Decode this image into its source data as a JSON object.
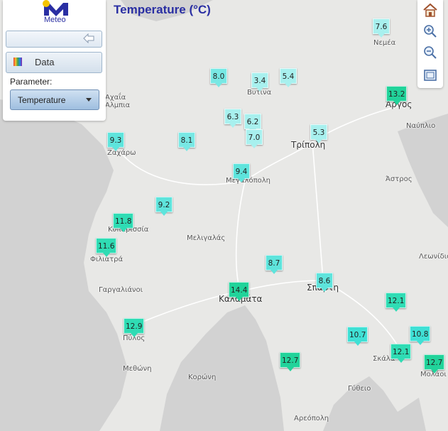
{
  "app": {
    "logo_text": "Meteo",
    "title": "Temperature (°C)"
  },
  "panel": {
    "data_button_label": "Data",
    "parameter_label": "Parameter:",
    "parameter_value": "Temperature"
  },
  "toolbar": {
    "icons": [
      "home-icon",
      "zoom-in-icon",
      "zoom-out-icon",
      "zoom-extent-icon"
    ]
  },
  "colors": {
    "title": "#2a2fa3",
    "marker_low": "#a8f0ee",
    "marker_mid": "#3fe0d5",
    "marker_high": "#21d39a"
  },
  "places": [
    "Νεμέα",
    "Αχαΐα",
    "Αλμπια",
    "Βυτινα",
    "Άργος",
    "Ναύπλιο",
    "Τρίπολη",
    "Ζαχάρω",
    "Μεγαλόπολη",
    "Άστρος",
    "Κυπαρισσία",
    "Μελιγαλάς",
    "Φιλιατρά",
    "Λεωνίδιο",
    "Γαργαλιάνοι",
    "Σπάρτη",
    "Καλαμάτα",
    "Πύλος",
    "Σκάλα",
    "Μεθώνη",
    "Κορώνη",
    "Γύθειο",
    "Μολάοι",
    "Αρεόπολη"
  ],
  "stations": [
    {
      "value": "7.6"
    },
    {
      "value": "3.4"
    },
    {
      "value": "5.4"
    },
    {
      "value": "8.0"
    },
    {
      "value": "13.2"
    },
    {
      "value": "6.3"
    },
    {
      "value": "6.2"
    },
    {
      "value": "7.0"
    },
    {
      "value": "5.3"
    },
    {
      "value": "9.3"
    },
    {
      "value": "8.1"
    },
    {
      "value": "9.4"
    },
    {
      "value": "9.2"
    },
    {
      "value": "11.8"
    },
    {
      "value": "11.6"
    },
    {
      "value": "8.7"
    },
    {
      "value": "8.6"
    },
    {
      "value": "14.4"
    },
    {
      "value": "12.1"
    },
    {
      "value": "12.9"
    },
    {
      "value": "10.7"
    },
    {
      "value": "10.8"
    },
    {
      "value": "12.1"
    },
    {
      "value": "12.7"
    },
    {
      "value": "12.7"
    }
  ]
}
